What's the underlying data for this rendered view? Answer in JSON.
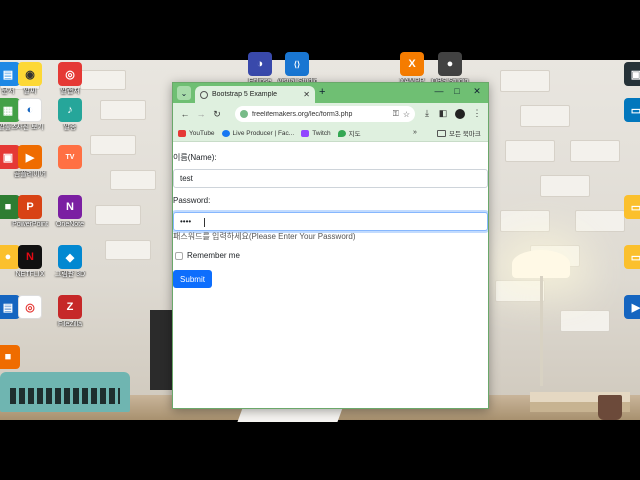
{
  "desktop": {
    "icons": [
      {
        "label": "문서",
        "color": "#1e88e5",
        "glyph": "▤"
      },
      {
        "label": "알씨",
        "color": "#fdd835",
        "glyph": "◉"
      },
      {
        "label": "알캡처",
        "color": "#e53935",
        "glyph": "◎"
      },
      {
        "label": "알툴즈",
        "color": "#43a047",
        "glyph": "▦"
      },
      {
        "label": "PowerPoint",
        "color": "#d84315",
        "glyph": "P"
      },
      {
        "label": "NETFLIX",
        "color": "#b71c1c",
        "glyph": "N"
      },
      {
        "label": "사진 보기",
        "color": "#1565c0",
        "glyph": "◐"
      },
      {
        "label": "알송",
        "color": "#6a1b9a",
        "glyph": "♪"
      },
      {
        "label": "곰플레이어",
        "color": "#ef6c00",
        "glyph": "▶"
      },
      {
        "label": "OneNote",
        "color": "#7b1fa2",
        "glyph": "N"
      },
      {
        "label": "그림판 3D",
        "color": "#0288d1",
        "glyph": "◆"
      },
      {
        "label": "FileZilla",
        "color": "#c62828",
        "glyph": "Z"
      },
      {
        "label": "Eclipse",
        "color": "#3949ab",
        "glyph": "◑"
      },
      {
        "label": "Visual Studio Code",
        "color": "#1976d2",
        "glyph": "⟨⟩"
      },
      {
        "label": "XAMPP",
        "color": "#f57c00",
        "glyph": "X"
      },
      {
        "label": "OBS Studio",
        "color": "#424242",
        "glyph": "●"
      }
    ]
  },
  "browser": {
    "tab_title": "Bootstrap 5 Example",
    "url": "freelifemakers.org/lec/form3.php",
    "bookmarks": [
      {
        "label": "YouTube",
        "color": "#e53935"
      },
      {
        "label": "Live Producer | Fac...",
        "color": "#1877f2"
      },
      {
        "label": "Twitch",
        "color": "#9146ff"
      },
      {
        "label": "지도",
        "color": "#34a853"
      }
    ],
    "bookmarks_more": "»",
    "all_bookmarks": "모든 북마크"
  },
  "form": {
    "name_label": "이름(Name):",
    "name_value": "test",
    "password_label": "Password:",
    "password_value": "••••",
    "password_help": "패스워드를 입력하세요(Please Enter Your Password)",
    "remember_label": "Remember me",
    "submit_label": "Submit"
  }
}
